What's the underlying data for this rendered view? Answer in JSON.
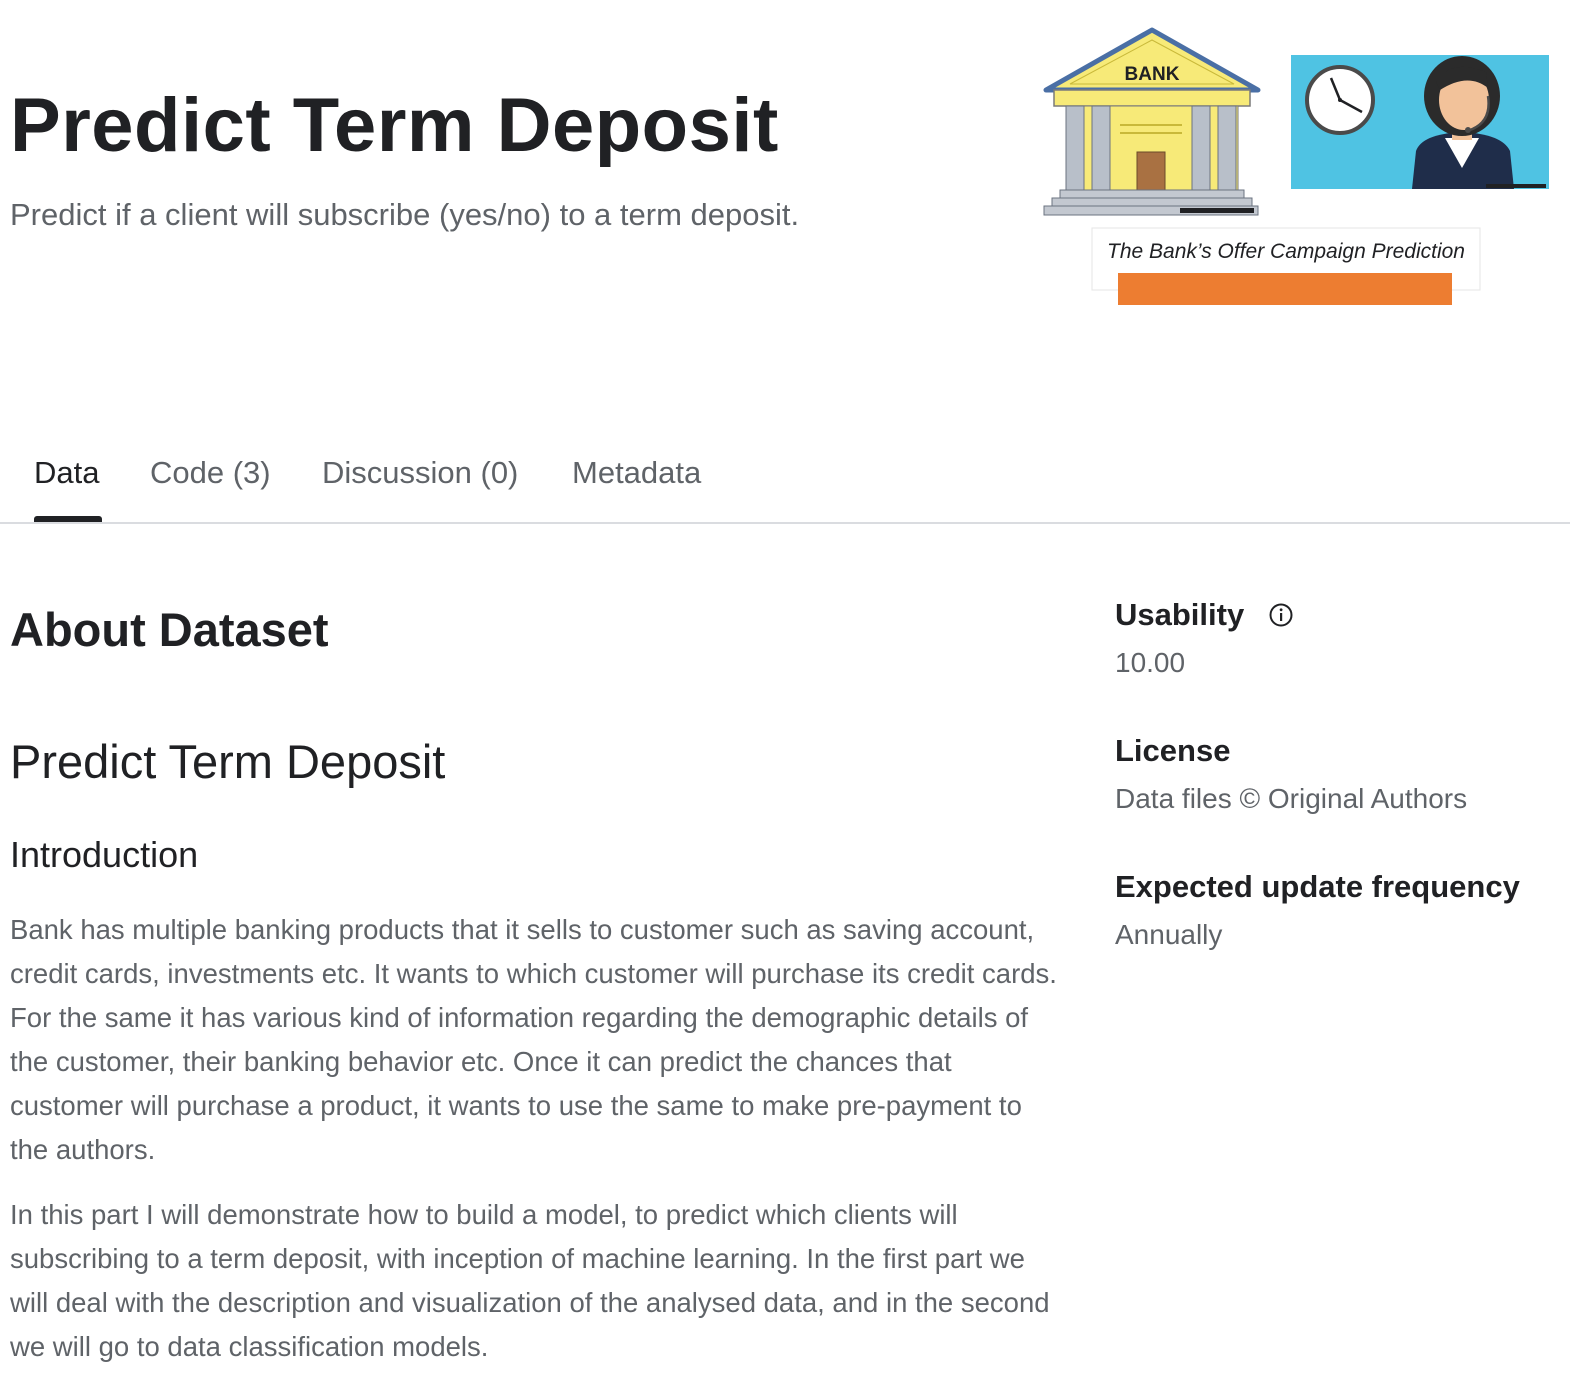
{
  "header": {
    "title": "Predict Term Deposit",
    "subtitle": "Predict if a client will subscribe (yes/no) to a term deposit."
  },
  "banner": {
    "bank_sign": "BANK",
    "caption": "The Bank’s Offer Campaign Prediction",
    "colors": {
      "bank_yellow": "#f7ea78",
      "sky_blue": "#4fc3e3",
      "caption_bar": "#ed7d31"
    },
    "icons": [
      "bank-building-icon",
      "clock-icon",
      "call-center-agent-icon"
    ]
  },
  "tabs": [
    {
      "label": "Data",
      "active": true
    },
    {
      "label": "Code (3)",
      "active": false
    },
    {
      "label": "Discussion (0)",
      "active": false
    },
    {
      "label": "Metadata",
      "active": false
    }
  ],
  "main": {
    "section_heading": "About Dataset",
    "doc_title": "Predict Term Deposit",
    "intro_heading": "Introduction",
    "paragraphs": [
      "Bank has multiple banking products that it sells to customer such as saving account, credit cards, investments etc. It wants to which customer will purchase its credit cards. For the same it has various kind of information regarding the demographic details of the customer, their banking behavior etc. Once it can predict the chances that customer will purchase a product, it wants to use the same to make pre-payment to the authors.",
      "In this part I will demonstrate how to build a model, to predict which clients will subscribing to a term deposit, with inception of machine learning. In the first part we will deal with the description and visualization of the analysed data, and in the second we will go to data classification models."
    ]
  },
  "sidebar": {
    "usability": {
      "label": "Usability",
      "value": "10.00"
    },
    "license": {
      "label": "License",
      "value": "Data files © Original Authors"
    },
    "update_frequency": {
      "label": "Expected update frequency",
      "value": "Annually"
    }
  }
}
